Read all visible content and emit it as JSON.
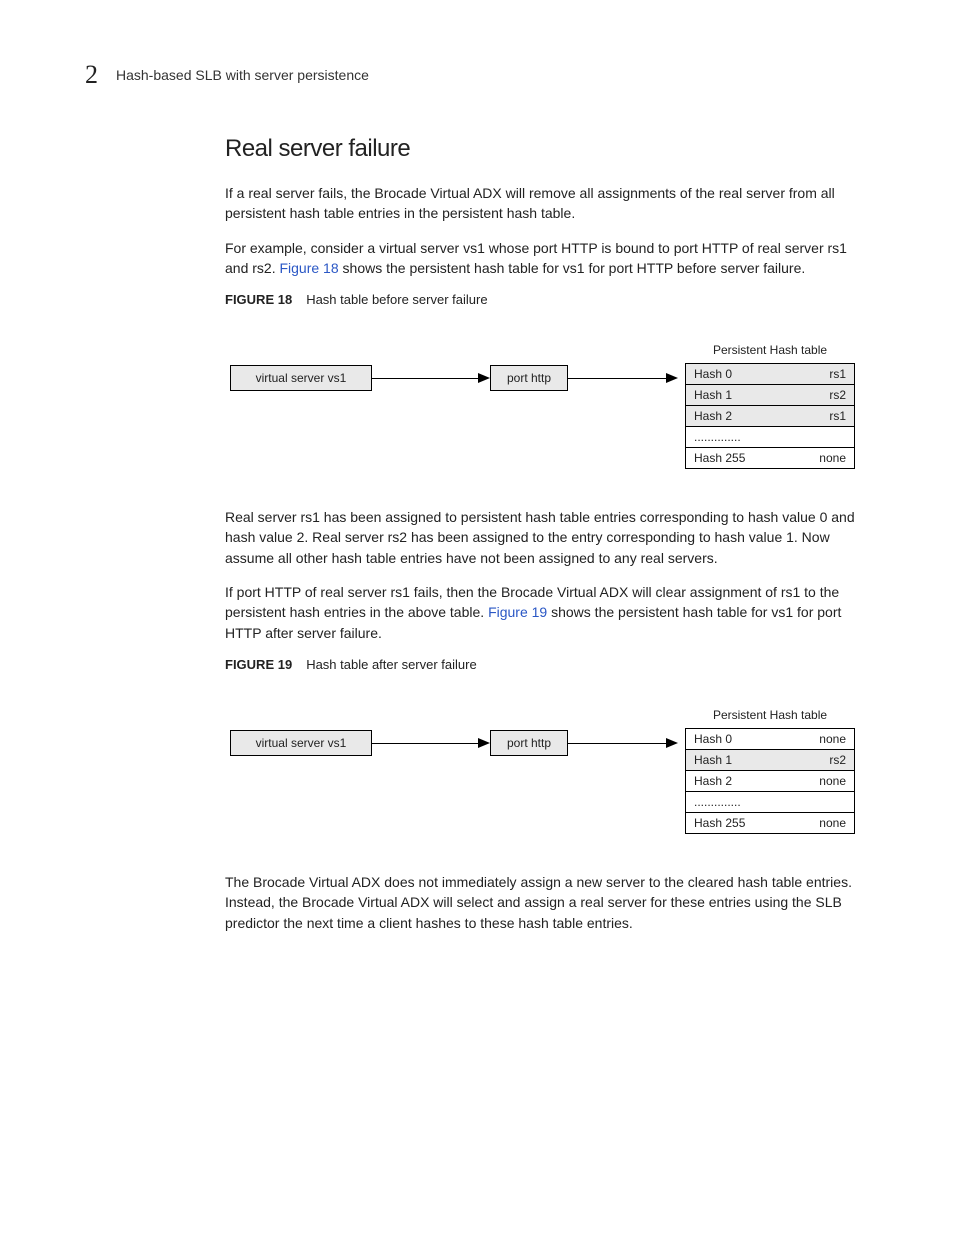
{
  "header": {
    "chapter": "2",
    "title": "Hash-based SLB with server persistence"
  },
  "section": {
    "title": "Real server failure",
    "p1": "If a real server fails, the Brocade Virtual ADX will remove all assignments of the real server from all persistent hash table entries in the persistent hash table.",
    "p2a": "For example, consider a virtual server vs1 whose port HTTP is bound to port HTTP of real server rs1 and rs2. ",
    "p2link": "Figure 18",
    "p2b": " shows the persistent hash table for vs1 for port HTTP before server failure.",
    "fig18": {
      "label": "FIGURE 18",
      "caption": "Hash table before server failure"
    },
    "p3": "Real server rs1 has been assigned to persistent hash table entries corresponding to hash value 0 and hash value 2. Real server rs2 has been assigned to the entry corresponding to hash value 1. Now assume all other hash table entries have not been assigned to any real servers.",
    "p4a": "If port HTTP of real server rs1 fails, then the Brocade Virtual ADX will clear assignment of rs1 to the persistent hash entries in the above table. ",
    "p4link": "Figure 19",
    "p4b": " shows the persistent hash table for vs1 for port HTTP after server failure.",
    "fig19": {
      "label": "FIGURE 19",
      "caption": "Hash table after server failure"
    },
    "p5": "The Brocade Virtual ADX does not immediately assign a new server to the cleared hash table entries. Instead, the Brocade Virtual ADX will select and assign a real server for these entries using the SLB predictor the next time a client hashes to these hash table entries."
  },
  "diagram": {
    "vsLabel": "virtual server vs1",
    "portLabel": "port http",
    "tableTitle": "Persistent Hash table",
    "rows18": [
      {
        "k": "Hash 0",
        "v": "rs1",
        "hl": true
      },
      {
        "k": "Hash 1",
        "v": "rs2",
        "hl": true
      },
      {
        "k": "Hash 2",
        "v": "rs1",
        "hl": true
      },
      {
        "k": "..............",
        "v": "",
        "hl": false
      },
      {
        "k": "Hash 255",
        "v": "none",
        "hl": false
      }
    ],
    "rows19": [
      {
        "k": "Hash 0",
        "v": "none",
        "hl": false
      },
      {
        "k": "Hash 1",
        "v": "rs2",
        "hl": true
      },
      {
        "k": "Hash 2",
        "v": "none",
        "hl": false
      },
      {
        "k": "..............",
        "v": "",
        "hl": false
      },
      {
        "k": "Hash 255",
        "v": "none",
        "hl": false
      }
    ]
  }
}
